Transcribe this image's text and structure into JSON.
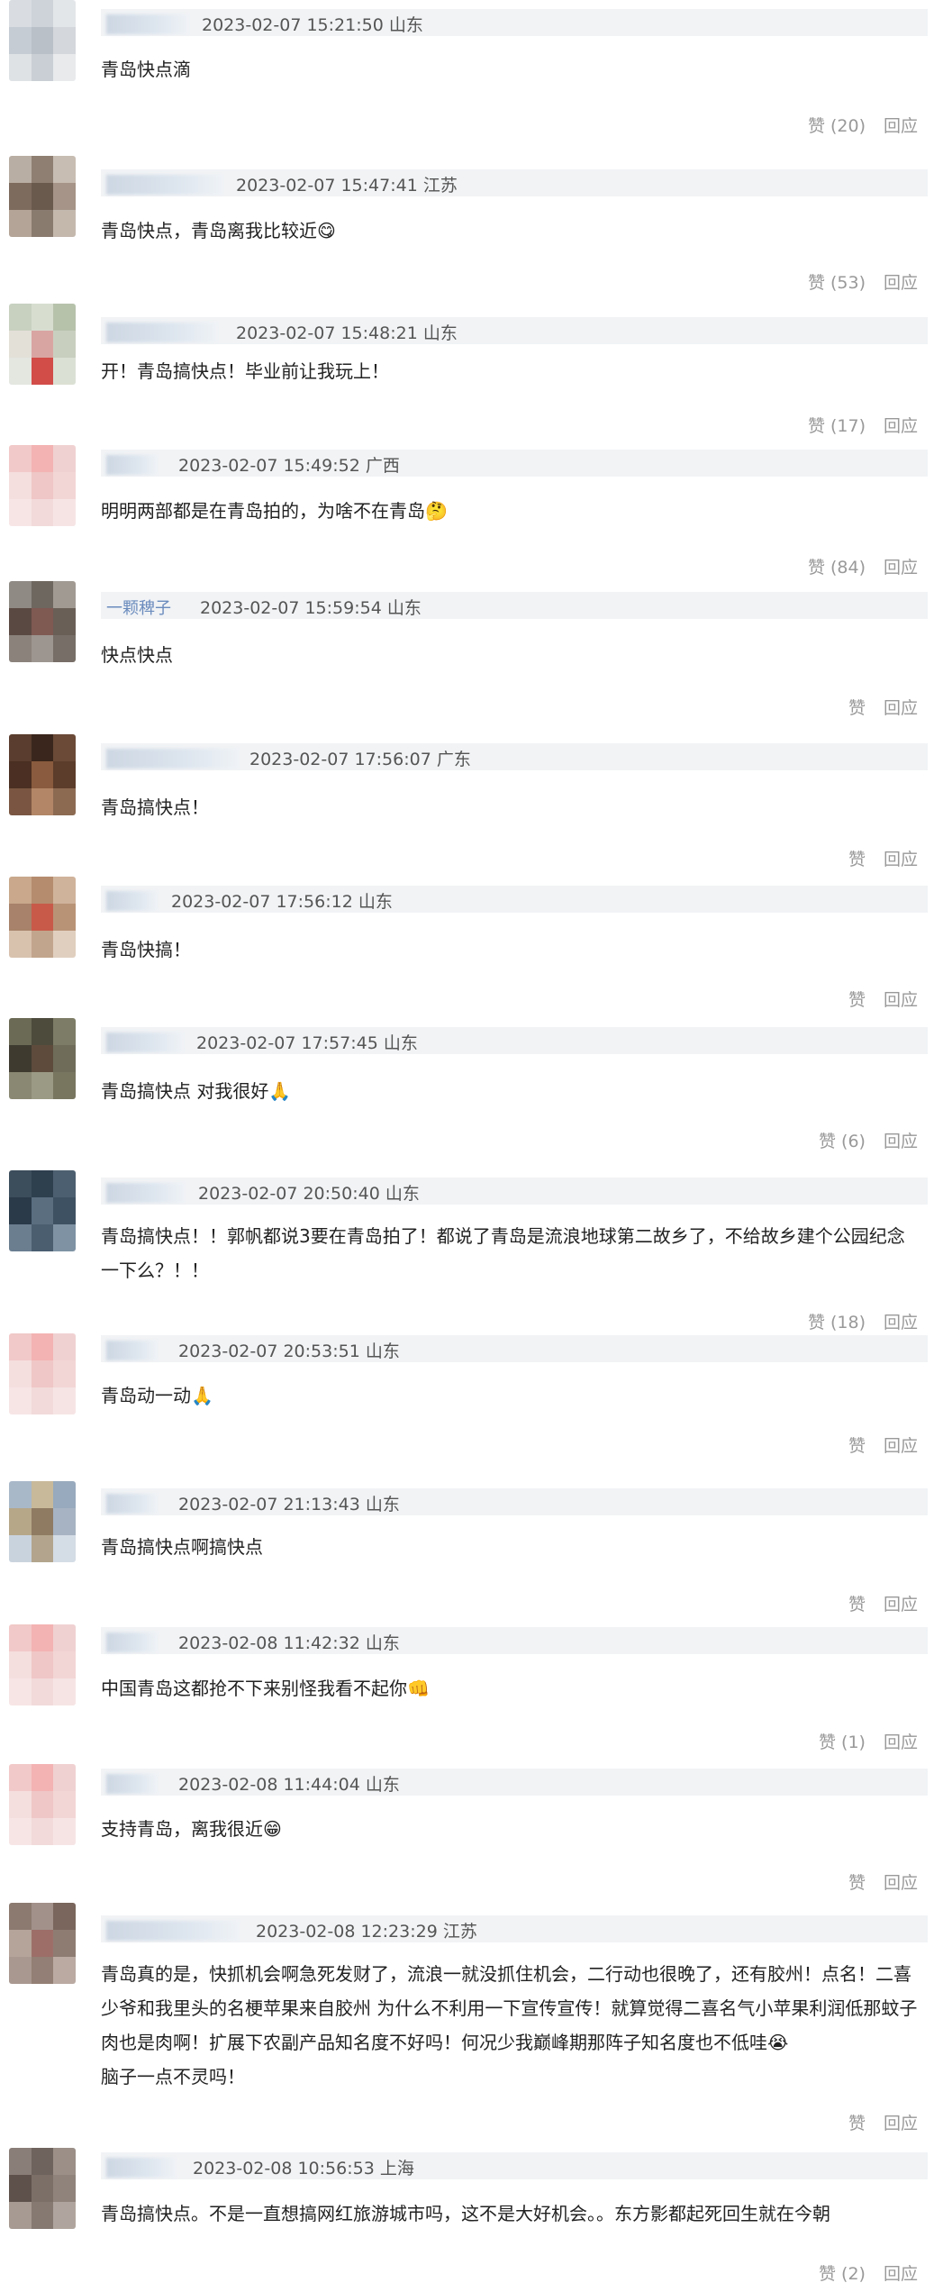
{
  "comments": [
    {
      "name": "",
      "time": "2023-02-07 15:21:50",
      "loc": "山东",
      "text": "青岛快点滴",
      "emoji": "",
      "likes": "赞 (20)",
      "reply": "回应"
    },
    {
      "name": "",
      "time": "2023-02-07 15:47:41",
      "loc": "江苏",
      "text": "青岛快点，青岛离我比较近",
      "emoji": "😋",
      "likes": "赞 (53)",
      "reply": "回应"
    },
    {
      "name": "",
      "time": "2023-02-07 15:48:21",
      "loc": "山东",
      "text": "开！青岛搞快点！毕业前让我玩上！",
      "emoji": "",
      "likes": "赞 (17)",
      "reply": "回应"
    },
    {
      "name": "",
      "time": "2023-02-07 15:49:52",
      "loc": "广西",
      "text": "明明两部都是在青岛拍的，为啥不在青岛",
      "emoji": "🤔",
      "likes": "赞 (84)",
      "reply": "回应"
    },
    {
      "name": "一颗稗子",
      "time": "2023-02-07 15:59:54",
      "loc": "山东",
      "text": "快点快点",
      "emoji": "",
      "likes": "赞",
      "reply": "回应"
    },
    {
      "name": "",
      "time": "2023-02-07 17:56:07",
      "loc": "广东",
      "text": "青岛搞快点！",
      "emoji": "",
      "likes": "赞",
      "reply": "回应"
    },
    {
      "name": "",
      "time": "2023-02-07 17:56:12",
      "loc": "山东",
      "text": "青岛快搞！",
      "emoji": "",
      "likes": "赞",
      "reply": "回应"
    },
    {
      "name": "",
      "time": "2023-02-07 17:57:45",
      "loc": "山东",
      "text": "青岛搞快点 对我很好",
      "emoji": "🙏",
      "likes": "赞 (6)",
      "reply": "回应"
    },
    {
      "name": "",
      "time": "2023-02-07 20:50:40",
      "loc": "山东",
      "text": "青岛搞快点！！郭帆都说3要在青岛拍了！都说了青岛是流浪地球第二故乡了，不给故乡建个公园纪念一下么？！！",
      "emoji": "",
      "likes": "赞 (18)",
      "reply": "回应"
    },
    {
      "name": "",
      "time": "2023-02-07 20:53:51",
      "loc": "山东",
      "text": "青岛动一动",
      "emoji": "🙏",
      "likes": "赞",
      "reply": "回应"
    },
    {
      "name": "",
      "time": "2023-02-07 21:13:43",
      "loc": "山东",
      "text": "青岛搞快点啊搞快点",
      "emoji": "",
      "likes": "赞",
      "reply": "回应"
    },
    {
      "name": "",
      "time": "2023-02-08 11:42:32",
      "loc": "山东",
      "text": "中国青岛这都抢不下来别怪我看不起你",
      "emoji": "👊",
      "likes": "赞 (1)",
      "reply": "回应"
    },
    {
      "name": "",
      "time": "2023-02-08 11:44:04",
      "loc": "山东",
      "text": "支持青岛，离我很近",
      "emoji": "😁",
      "likes": "赞",
      "reply": "回应"
    },
    {
      "name": "",
      "time": "2023-02-08 12:23:29",
      "loc": "江苏",
      "text": "青岛真的是，快抓机会啊急死发财了，流浪一就没抓住机会，二行动也很晚了，还有胶州！点名！二喜少爷和我里头的名梗苹果来自胶州 为什么不利用一下宣传宣传！就算觉得二喜名气小苹果利润低那蚊子肉也是肉啊！扩展下农副产品知名度不好吗！何况少我巅峰期那阵子知名度也不低哇",
      "emoji": "😭",
      "extra": "脑子一点不灵吗！",
      "likes": "赞",
      "reply": "回应"
    },
    {
      "name": "",
      "time": "2023-02-08 10:56:53",
      "loc": "上海",
      "text": "青岛搞快点。不是一直想搞网红旅游城市吗，这不是大好机会。。东方影都起死回生就在今朝",
      "emoji": "",
      "likes": "赞 (2)",
      "reply": "回应"
    }
  ]
}
